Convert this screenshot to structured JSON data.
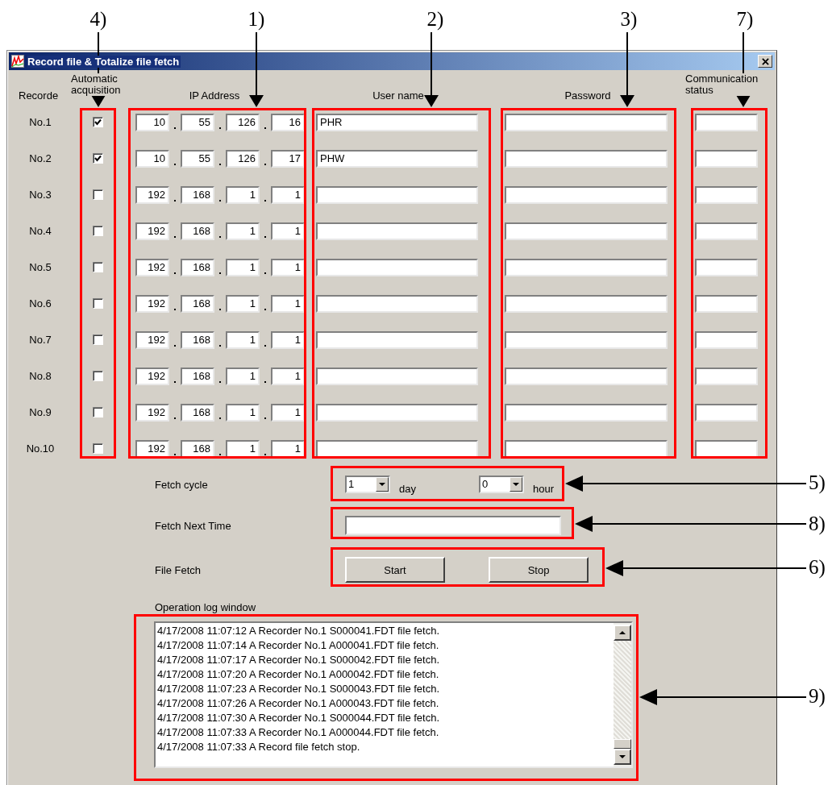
{
  "window": {
    "title": "Record file & Totalize file fetch"
  },
  "headers": {
    "recorder": "Recorde",
    "auto": "Automatic acquisition",
    "ip": "IP Address",
    "user": "User name",
    "password": "Password",
    "status": "Communication status"
  },
  "recorders": [
    {
      "label": "No.1",
      "auto_acquisition": true,
      "ip": [
        "10",
        "55",
        "126",
        "16"
      ],
      "user_name": "PHR"
    },
    {
      "label": "No.2",
      "auto_acquisition": true,
      "ip": [
        "10",
        "55",
        "126",
        "17"
      ],
      "user_name": "PHW"
    },
    {
      "label": "No.3",
      "auto_acquisition": false,
      "ip": [
        "192",
        "168",
        "1",
        "1"
      ]
    },
    {
      "label": "No.4",
      "auto_acquisition": false,
      "ip": [
        "192",
        "168",
        "1",
        "1"
      ]
    },
    {
      "label": "No.5",
      "auto_acquisition": false,
      "ip": [
        "192",
        "168",
        "1",
        "1"
      ]
    },
    {
      "label": "No.6",
      "auto_acquisition": false,
      "ip": [
        "192",
        "168",
        "1",
        "1"
      ]
    },
    {
      "label": "No.7",
      "auto_acquisition": false,
      "ip": [
        "192",
        "168",
        "1",
        "1"
      ]
    },
    {
      "label": "No.8",
      "auto_acquisition": false,
      "ip": [
        "192",
        "168",
        "1",
        "1"
      ]
    },
    {
      "label": "No.9",
      "auto_acquisition": false,
      "ip": [
        "192",
        "168",
        "1",
        "1"
      ]
    },
    {
      "label": "No.10",
      "auto_acquisition": false,
      "ip": [
        "192",
        "168",
        "1",
        "1"
      ]
    }
  ],
  "fetch_cycle": {
    "label": "Fetch cycle",
    "day_value": "1",
    "day_unit": "day",
    "hour_value": "0",
    "hour_unit": "hour"
  },
  "fetch_next_time": {
    "label": "Fetch Next Time"
  },
  "file_fetch": {
    "label": "File Fetch",
    "buttons": [
      "Start",
      "Stop"
    ]
  },
  "log": {
    "label": "Operation log window",
    "lines": [
      "4/17/2008 11:07:12 A Recorder No.1 S000041.FDT file fetch.",
      "4/17/2008 11:07:14 A Recorder No.1 A000041.FDT file fetch.",
      "4/17/2008 11:07:17 A Recorder No.1 S000042.FDT file fetch.",
      "4/17/2008 11:07:20 A Recorder No.1 A000042.FDT file fetch.",
      "4/17/2008 11:07:23 A Recorder No.1 S000043.FDT file fetch.",
      "4/17/2008 11:07:26 A Recorder No.1 A000043.FDT file fetch.",
      "4/17/2008 11:07:30 A Recorder No.1 S000044.FDT file fetch.",
      "4/17/2008 11:07:33 A Recorder No.1 A000044.FDT file fetch.",
      "4/17/2008 11:07:33 A Record file fetch stop."
    ]
  },
  "callouts": [
    "4)",
    "1)",
    "2)",
    "3)",
    "7)",
    "5)",
    "8)",
    "6)",
    "9)"
  ]
}
